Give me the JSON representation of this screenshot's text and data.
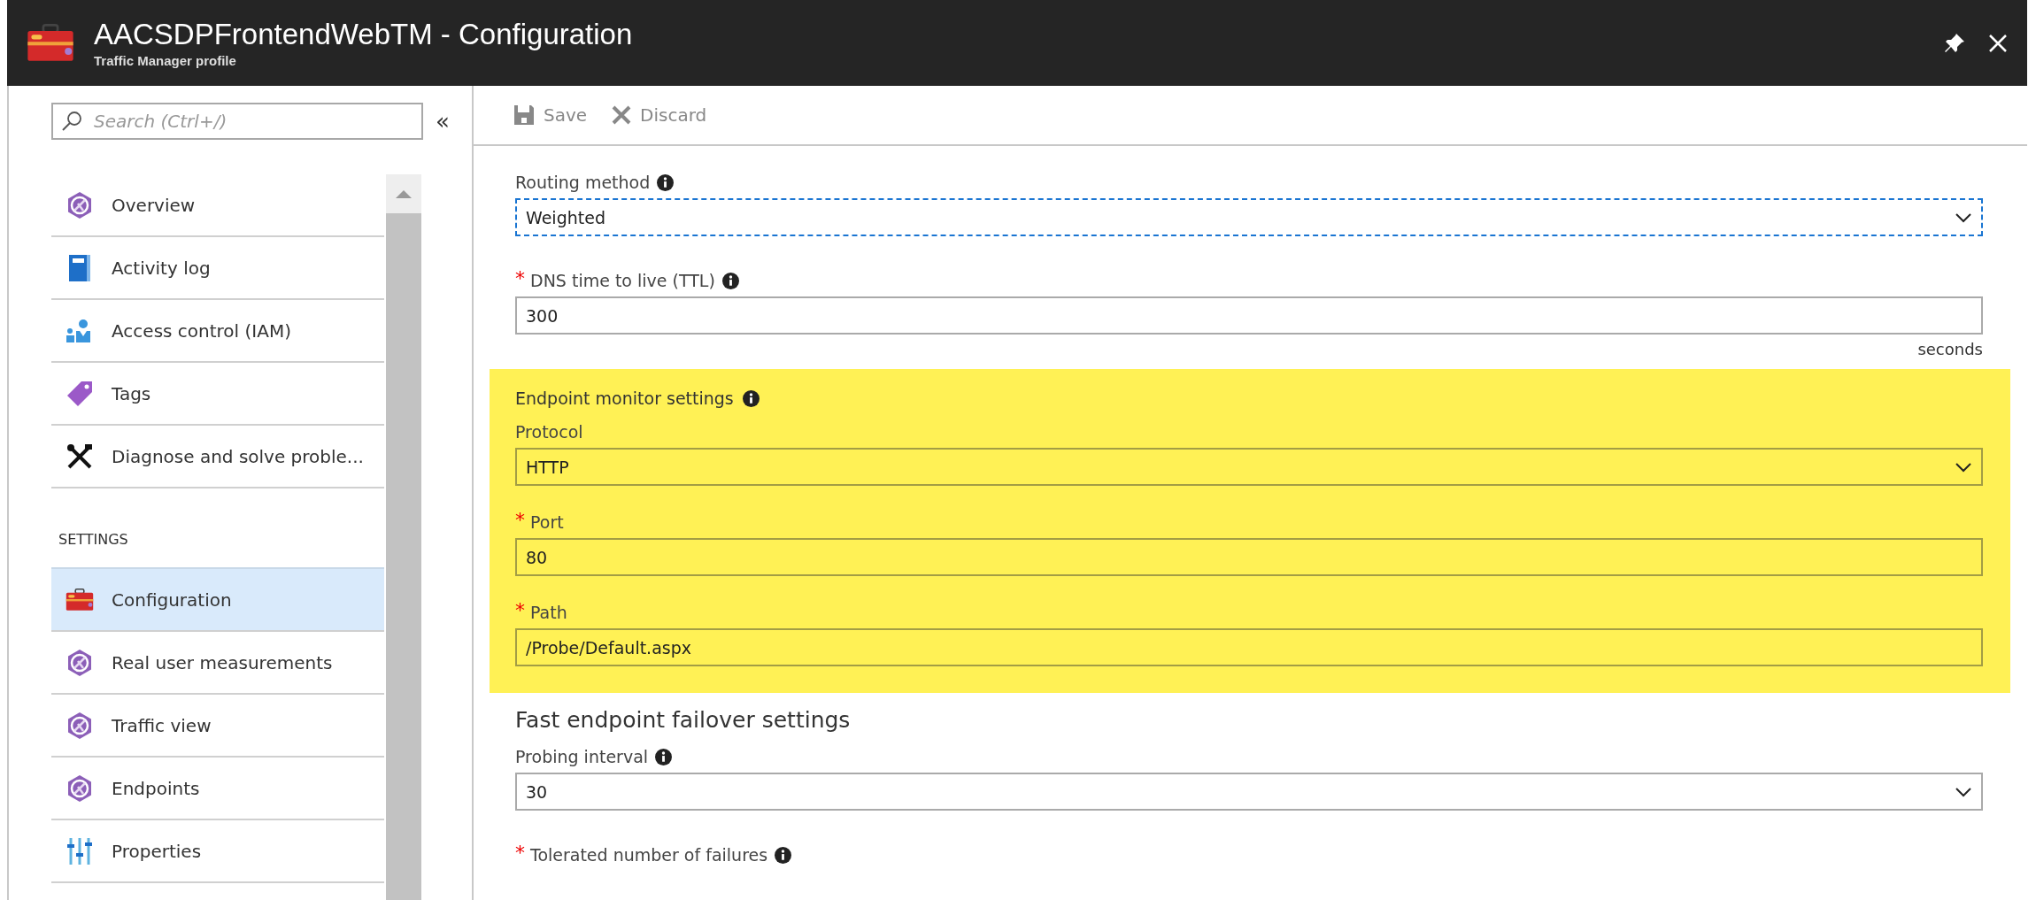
{
  "header": {
    "title": "AACSDPFrontendWebTM - Configuration",
    "subtitle": "Traffic Manager profile"
  },
  "sidebar": {
    "search": {
      "placeholder": "Search (Ctrl+/)"
    },
    "collapse": "«",
    "items": [
      {
        "kind": "item",
        "label": "Overview",
        "selected": false
      },
      {
        "kind": "item",
        "label": "Activity log",
        "selected": false
      },
      {
        "kind": "item",
        "label": "Access control (IAM)",
        "selected": false
      },
      {
        "kind": "item",
        "label": "Tags",
        "selected": false
      },
      {
        "kind": "item",
        "label": "Diagnose and solve proble...",
        "selected": false
      },
      {
        "kind": "header",
        "label": "SETTINGS"
      },
      {
        "kind": "item",
        "label": "Configuration",
        "selected": true
      },
      {
        "kind": "item",
        "label": "Real user measurements",
        "selected": false
      },
      {
        "kind": "item",
        "label": "Traffic view",
        "selected": false
      },
      {
        "kind": "item",
        "label": "Endpoints",
        "selected": false
      },
      {
        "kind": "item",
        "label": "Properties",
        "selected": false
      }
    ]
  },
  "toolbar": [
    {
      "label": "Save",
      "disabled": true
    },
    {
      "label": "Discard",
      "disabled": true
    }
  ],
  "form": {
    "fields": [
      {
        "kind": "select",
        "label": "Routing method",
        "info": true,
        "value": "Weighted",
        "focused": true
      },
      {
        "kind": "input",
        "label": "DNS time to live (TTL)",
        "required_mark": "*",
        "info": true,
        "value": "300",
        "suffix": "seconds"
      }
    ],
    "monitor": {
      "heading": "Endpoint monitor settings",
      "info": true,
      "highlighted": true,
      "fields": [
        {
          "kind": "select",
          "label": "Protocol",
          "info": false,
          "value": "HTTP"
        },
        {
          "kind": "input",
          "label": "Port",
          "required_mark": "*",
          "info": false,
          "value": "80"
        },
        {
          "kind": "input",
          "label": "Path",
          "required_mark": "*",
          "info": false,
          "value": "/Probe/Default.aspx"
        }
      ]
    },
    "failover": {
      "heading": "Fast endpoint failover settings",
      "fields": [
        {
          "kind": "select",
          "label": "Probing interval",
          "info": true,
          "value": "30"
        },
        {
          "kind": "label",
          "label": "Tolerated number of failures",
          "required_mark": "*",
          "info": true
        }
      ]
    }
  }
}
